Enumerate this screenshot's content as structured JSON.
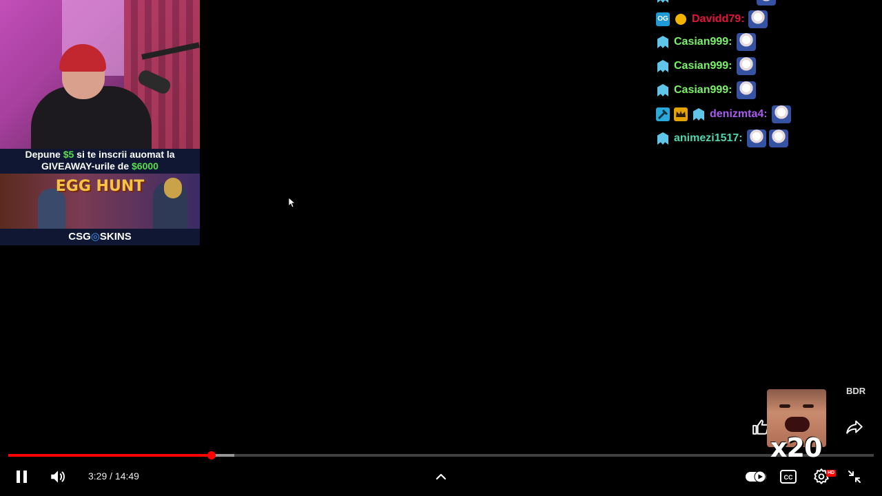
{
  "promo": {
    "line1_a": "Depune ",
    "line1_amount": "$5",
    "line1_b": " si te inscrii auomat la",
    "line2_a": "GIVEAWAY-urile de ",
    "line2_amount": "$6000",
    "banner_title": "EGG HUNT",
    "footer_left": "CSG",
    "footer_right": "SKINS",
    "accent_green": "#56e04e",
    "banner_title_color": "#f6c445"
  },
  "chat": {
    "messages": [
      {
        "username": "Davidd79:",
        "color": "#e2143b",
        "badges": [
          "og-badge-icon",
          "clown-badge-icon"
        ],
        "emotes": 1
      },
      {
        "username": "Casian999:",
        "color": "#7cf26a",
        "badges": [
          "subscriber-badge-icon"
        ],
        "emotes": 1
      },
      {
        "username": "Casian999:",
        "color": "#7cf26a",
        "badges": [
          "subscriber-badge-icon"
        ],
        "emotes": 1
      },
      {
        "username": "Casian999:",
        "color": "#7cf26a",
        "badges": [
          "subscriber-badge-icon"
        ],
        "emotes": 1
      },
      {
        "username": "denizmta4:",
        "color": "#a85cf0",
        "badges": [
          "moderator-badge-icon",
          "crown-badge-icon",
          "subscriber-badge-icon"
        ],
        "emotes": 1
      },
      {
        "username": "animezi1517:",
        "color": "#4fd6b0",
        "badges": [
          "subscriber-badge-icon"
        ],
        "emotes": 2
      }
    ]
  },
  "overlay": {
    "watermark": "BDR",
    "reaction_count": "x20"
  },
  "player": {
    "current_time": "3:29",
    "duration": "14:49",
    "time_display": "3:29 / 14:49",
    "played_fraction": 0.235,
    "buffered_fraction": 0.261,
    "quality_badge": "HD",
    "progress_color": "#ff0000"
  }
}
